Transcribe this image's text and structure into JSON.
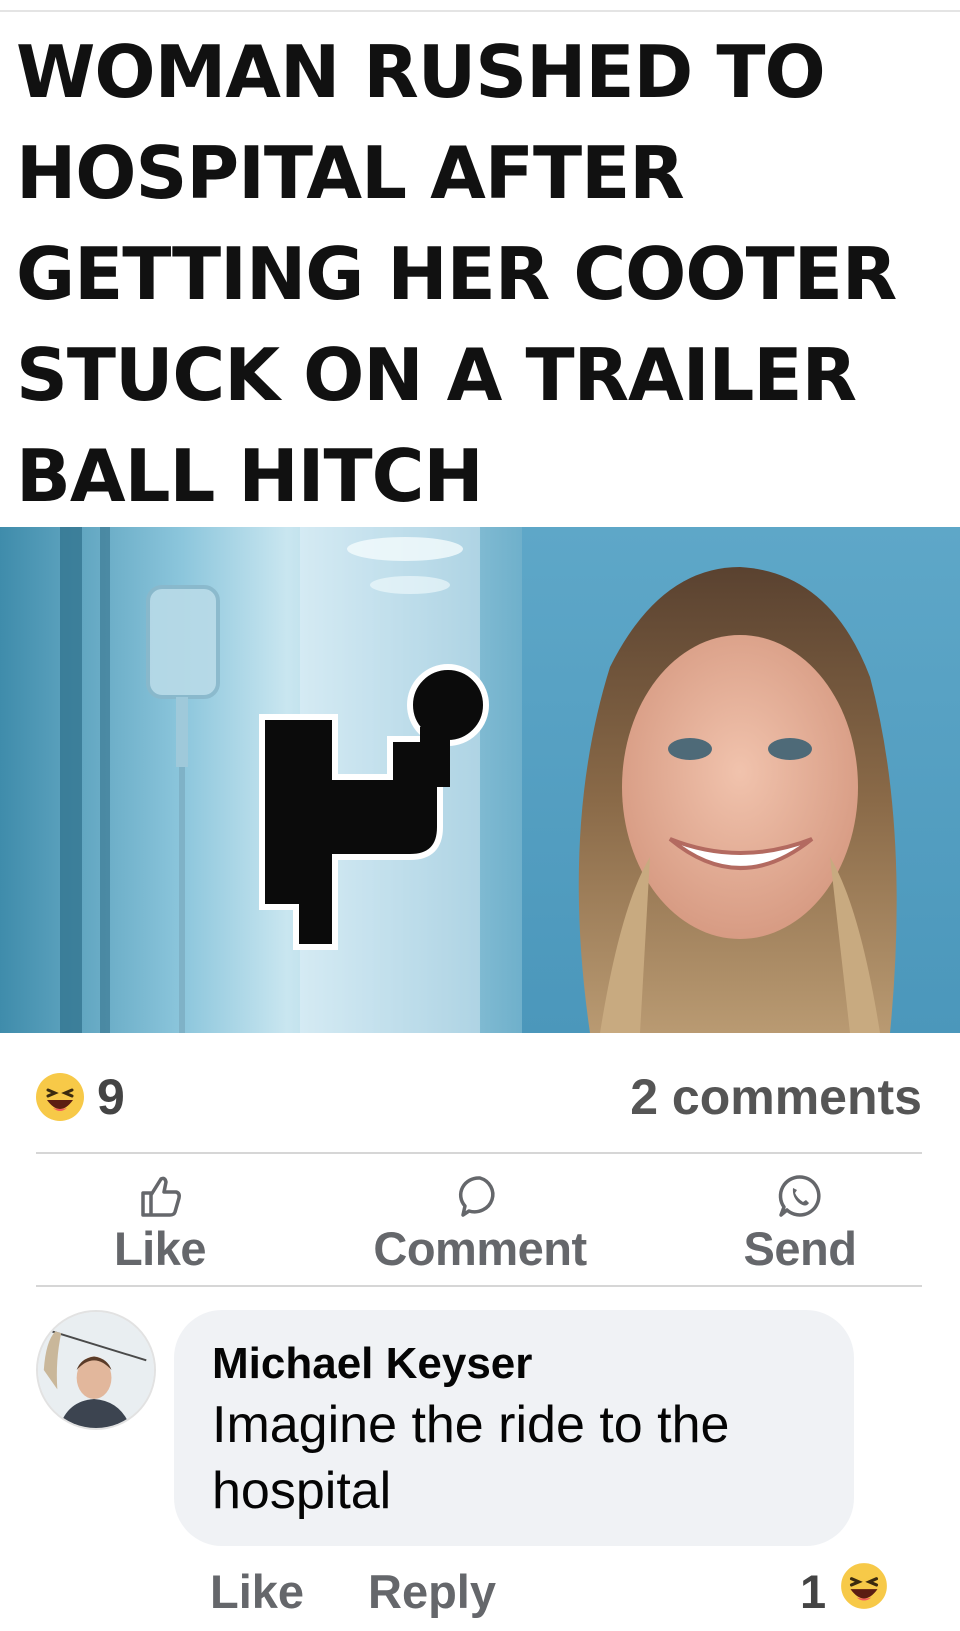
{
  "post": {
    "headline_lines": [
      "WOMAN RUSHED TO",
      "HOSPITAL AFTER",
      "GETTING HER COOTER",
      "STUCK ON A TRAILER",
      "BALL HITCH"
    ]
  },
  "reactions": {
    "emoji": "haha-emoji-icon",
    "count": "9",
    "comments": "2 comments"
  },
  "actions": {
    "like": "Like",
    "comment": "Comment",
    "send": "Send"
  },
  "comment": {
    "author": "Michael Keyser",
    "text": "Imagine the ride to the hospital",
    "like": "Like",
    "reply": "Reply",
    "reaction_count": "1",
    "reaction_emoji": "haha-emoji-icon"
  },
  "colors": {
    "action_gray": "#65676b",
    "bubble_bg": "#f0f2f5",
    "photo_blue": "#5fa6c4"
  }
}
